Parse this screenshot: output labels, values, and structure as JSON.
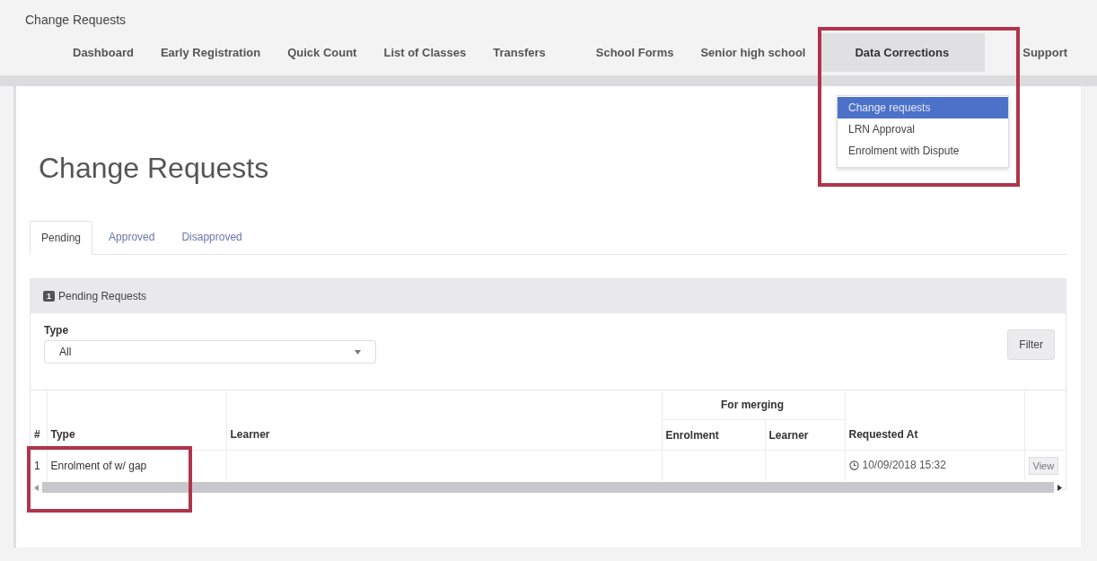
{
  "app_title": "Change Requests",
  "nav": [
    {
      "label": "Dashboard",
      "selected": false
    },
    {
      "label": "Early Registration",
      "selected": false
    },
    {
      "label": "Quick Count",
      "selected": false
    },
    {
      "label": "List of Classes",
      "selected": false
    },
    {
      "label": "Transfers",
      "selected": false
    },
    {
      "label": "School Forms",
      "selected": false
    },
    {
      "label": "Senior high school",
      "selected": false
    },
    {
      "label": "Data Corrections",
      "selected": true
    },
    {
      "label": "Support",
      "selected": false
    }
  ],
  "dropdown": [
    {
      "label": "Change requests",
      "selected": true
    },
    {
      "label": "LRN Approval",
      "selected": false
    },
    {
      "label": "Enrolment with Dispute",
      "selected": false
    }
  ],
  "page_heading": "Change Requests",
  "tabs": [
    {
      "label": "Pending",
      "selected": true
    },
    {
      "label": "Approved",
      "selected": false
    },
    {
      "label": "Disapproved",
      "selected": false
    }
  ],
  "panel": {
    "badge": "1",
    "title": "Pending Requests",
    "filter_label": "Type",
    "filter_value": "All",
    "filter_button": "Filter"
  },
  "table": {
    "group_header": "For merging",
    "columns": [
      "#",
      "Type",
      "Learner",
      "Enrolment",
      "Learner",
      "Requested At"
    ],
    "rows": [
      {
        "cells": [
          "1",
          "Enrolment of w/ gap",
          "",
          "",
          "",
          "10/09/2018 15:32"
        ],
        "action": "View"
      }
    ]
  }
}
